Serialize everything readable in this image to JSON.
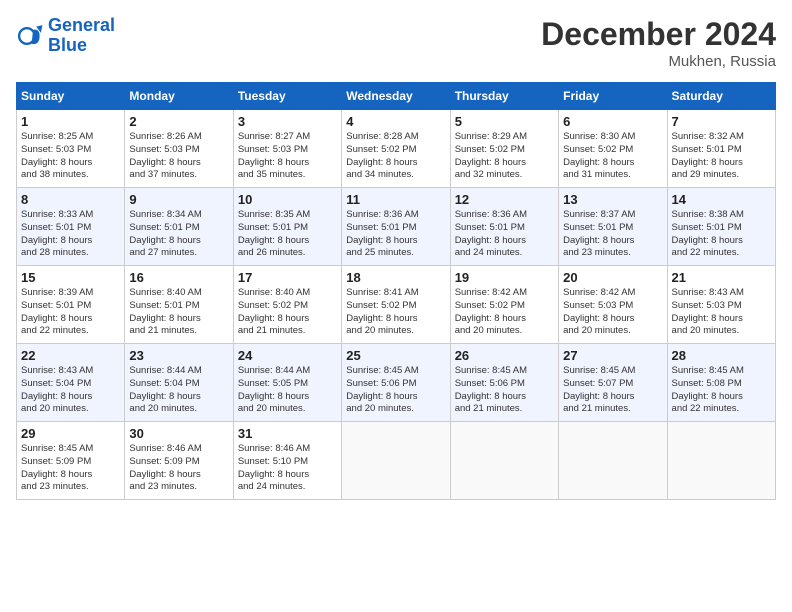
{
  "header": {
    "logo_line1": "General",
    "logo_line2": "Blue",
    "month": "December 2024",
    "location": "Mukhen, Russia"
  },
  "weekdays": [
    "Sunday",
    "Monday",
    "Tuesday",
    "Wednesday",
    "Thursday",
    "Friday",
    "Saturday"
  ],
  "weeks": [
    [
      {
        "day": "1",
        "info": "Sunrise: 8:25 AM\nSunset: 5:03 PM\nDaylight: 8 hours\nand 38 minutes."
      },
      {
        "day": "2",
        "info": "Sunrise: 8:26 AM\nSunset: 5:03 PM\nDaylight: 8 hours\nand 37 minutes."
      },
      {
        "day": "3",
        "info": "Sunrise: 8:27 AM\nSunset: 5:03 PM\nDaylight: 8 hours\nand 35 minutes."
      },
      {
        "day": "4",
        "info": "Sunrise: 8:28 AM\nSunset: 5:02 PM\nDaylight: 8 hours\nand 34 minutes."
      },
      {
        "day": "5",
        "info": "Sunrise: 8:29 AM\nSunset: 5:02 PM\nDaylight: 8 hours\nand 32 minutes."
      },
      {
        "day": "6",
        "info": "Sunrise: 8:30 AM\nSunset: 5:02 PM\nDaylight: 8 hours\nand 31 minutes."
      },
      {
        "day": "7",
        "info": "Sunrise: 8:32 AM\nSunset: 5:01 PM\nDaylight: 8 hours\nand 29 minutes."
      }
    ],
    [
      {
        "day": "8",
        "info": "Sunrise: 8:33 AM\nSunset: 5:01 PM\nDaylight: 8 hours\nand 28 minutes."
      },
      {
        "day": "9",
        "info": "Sunrise: 8:34 AM\nSunset: 5:01 PM\nDaylight: 8 hours\nand 27 minutes."
      },
      {
        "day": "10",
        "info": "Sunrise: 8:35 AM\nSunset: 5:01 PM\nDaylight: 8 hours\nand 26 minutes."
      },
      {
        "day": "11",
        "info": "Sunrise: 8:36 AM\nSunset: 5:01 PM\nDaylight: 8 hours\nand 25 minutes."
      },
      {
        "day": "12",
        "info": "Sunrise: 8:36 AM\nSunset: 5:01 PM\nDaylight: 8 hours\nand 24 minutes."
      },
      {
        "day": "13",
        "info": "Sunrise: 8:37 AM\nSunset: 5:01 PM\nDaylight: 8 hours\nand 23 minutes."
      },
      {
        "day": "14",
        "info": "Sunrise: 8:38 AM\nSunset: 5:01 PM\nDaylight: 8 hours\nand 22 minutes."
      }
    ],
    [
      {
        "day": "15",
        "info": "Sunrise: 8:39 AM\nSunset: 5:01 PM\nDaylight: 8 hours\nand 22 minutes."
      },
      {
        "day": "16",
        "info": "Sunrise: 8:40 AM\nSunset: 5:01 PM\nDaylight: 8 hours\nand 21 minutes."
      },
      {
        "day": "17",
        "info": "Sunrise: 8:40 AM\nSunset: 5:02 PM\nDaylight: 8 hours\nand 21 minutes."
      },
      {
        "day": "18",
        "info": "Sunrise: 8:41 AM\nSunset: 5:02 PM\nDaylight: 8 hours\nand 20 minutes."
      },
      {
        "day": "19",
        "info": "Sunrise: 8:42 AM\nSunset: 5:02 PM\nDaylight: 8 hours\nand 20 minutes."
      },
      {
        "day": "20",
        "info": "Sunrise: 8:42 AM\nSunset: 5:03 PM\nDaylight: 8 hours\nand 20 minutes."
      },
      {
        "day": "21",
        "info": "Sunrise: 8:43 AM\nSunset: 5:03 PM\nDaylight: 8 hours\nand 20 minutes."
      }
    ],
    [
      {
        "day": "22",
        "info": "Sunrise: 8:43 AM\nSunset: 5:04 PM\nDaylight: 8 hours\nand 20 minutes."
      },
      {
        "day": "23",
        "info": "Sunrise: 8:44 AM\nSunset: 5:04 PM\nDaylight: 8 hours\nand 20 minutes."
      },
      {
        "day": "24",
        "info": "Sunrise: 8:44 AM\nSunset: 5:05 PM\nDaylight: 8 hours\nand 20 minutes."
      },
      {
        "day": "25",
        "info": "Sunrise: 8:45 AM\nSunset: 5:06 PM\nDaylight: 8 hours\nand 20 minutes."
      },
      {
        "day": "26",
        "info": "Sunrise: 8:45 AM\nSunset: 5:06 PM\nDaylight: 8 hours\nand 21 minutes."
      },
      {
        "day": "27",
        "info": "Sunrise: 8:45 AM\nSunset: 5:07 PM\nDaylight: 8 hours\nand 21 minutes."
      },
      {
        "day": "28",
        "info": "Sunrise: 8:45 AM\nSunset: 5:08 PM\nDaylight: 8 hours\nand 22 minutes."
      }
    ],
    [
      {
        "day": "29",
        "info": "Sunrise: 8:45 AM\nSunset: 5:09 PM\nDaylight: 8 hours\nand 23 minutes."
      },
      {
        "day": "30",
        "info": "Sunrise: 8:46 AM\nSunset: 5:09 PM\nDaylight: 8 hours\nand 23 minutes."
      },
      {
        "day": "31",
        "info": "Sunrise: 8:46 AM\nSunset: 5:10 PM\nDaylight: 8 hours\nand 24 minutes."
      },
      {
        "day": "",
        "info": ""
      },
      {
        "day": "",
        "info": ""
      },
      {
        "day": "",
        "info": ""
      },
      {
        "day": "",
        "info": ""
      }
    ]
  ]
}
